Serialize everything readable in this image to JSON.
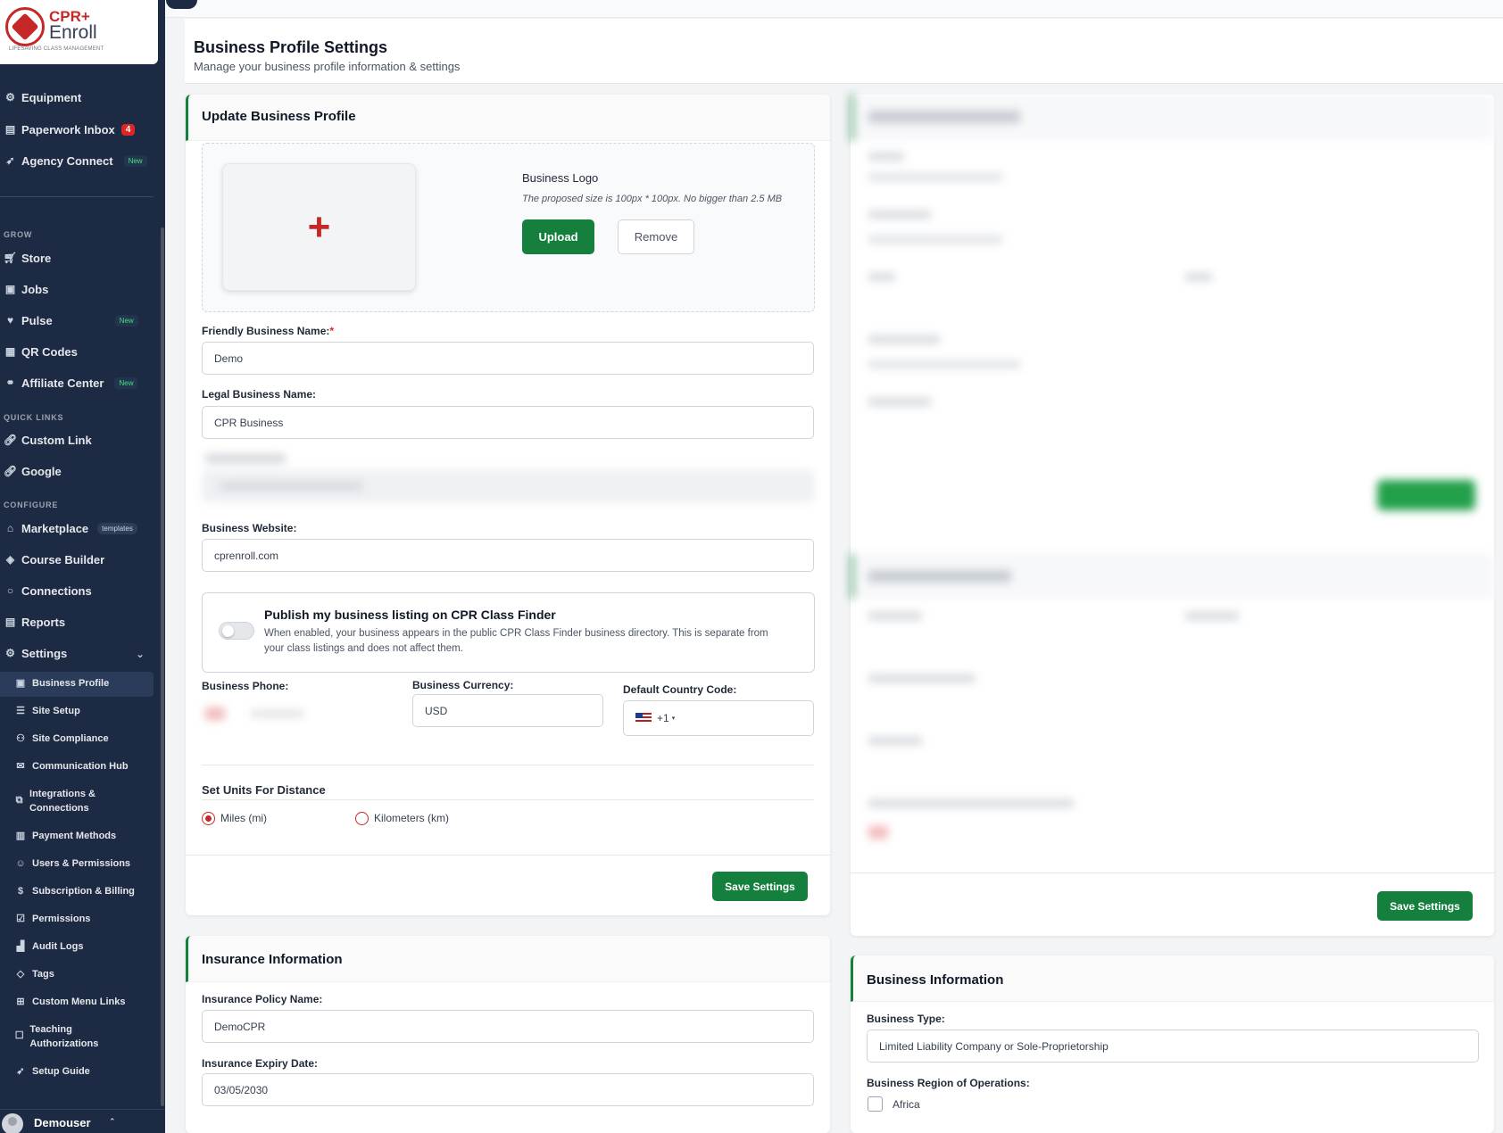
{
  "sidebar": {
    "logo_brand_top": "CPR+",
    "logo_brand_bottom": "Enroll",
    "logo_tagline": "LIFESAVING CLASS MANAGEMENT",
    "items_top": [
      {
        "label": "Equipment",
        "icon": "cog-group-icon"
      },
      {
        "label": "Paperwork Inbox",
        "icon": "inbox-icon",
        "badge": "4"
      },
      {
        "label": "Agency Connect",
        "icon": "rocket-icon",
        "badge": "New"
      }
    ],
    "section_grow": "GROW",
    "items_grow": [
      {
        "label": "Store",
        "icon": "cart-icon"
      },
      {
        "label": "Jobs",
        "icon": "briefcase-icon"
      },
      {
        "label": "Pulse",
        "icon": "heart-icon",
        "badge": "New"
      },
      {
        "label": "QR Codes",
        "icon": "qr-icon"
      },
      {
        "label": "Affiliate Center",
        "icon": "handshake-icon",
        "badge": "New"
      }
    ],
    "section_quick": "QUICK LINKS",
    "items_quick": [
      {
        "label": "Custom Link",
        "icon": "link-icon"
      },
      {
        "label": "Google",
        "icon": "link-icon"
      }
    ],
    "section_configure": "CONFIGURE",
    "items_configure": [
      {
        "label": "Marketplace",
        "icon": "store-icon",
        "badge": "templates"
      },
      {
        "label": "Course Builder",
        "icon": "graduation-icon"
      },
      {
        "label": "Connections",
        "icon": "plug-icon"
      },
      {
        "label": "Reports",
        "icon": "report-icon"
      },
      {
        "label": "Settings",
        "icon": "gear-icon"
      }
    ],
    "settings_sub": [
      {
        "label": "Business Profile",
        "icon": "building-icon"
      },
      {
        "label": "Site Setup",
        "icon": "sliders-icon"
      },
      {
        "label": "Site Compliance",
        "icon": "users-cog-icon"
      },
      {
        "label": "Communication Hub",
        "icon": "mail-icon"
      },
      {
        "label": "Integrations & Connections",
        "icon": "network-icon"
      },
      {
        "label": "Payment Methods",
        "icon": "receipt-icon"
      },
      {
        "label": "Users & Permissions",
        "icon": "user-icon"
      },
      {
        "label": "Subscription & Billing",
        "icon": "search-dollar-icon"
      },
      {
        "label": "Permissions",
        "icon": "clipboard-check-icon"
      },
      {
        "label": "Audit Logs",
        "icon": "chart-icon"
      },
      {
        "label": "Tags",
        "icon": "tag-icon"
      },
      {
        "label": "Custom Menu Links",
        "icon": "sitemap-icon"
      },
      {
        "label": "Teaching Authorizations",
        "icon": "clipboard-icon"
      },
      {
        "label": "Setup Guide",
        "icon": "rocket-icon"
      }
    ],
    "user_name": "Demouser"
  },
  "page": {
    "title": "Business Profile Settings",
    "subtitle": "Manage your business profile information & settings"
  },
  "profile_card": {
    "title": "Update Business Profile",
    "logo_label": "Business Logo",
    "logo_hint": "The proposed size is 100px * 100px. No bigger than 2.5 MB",
    "upload_label": "Upload",
    "remove_label": "Remove",
    "friendly_name_label": "Friendly Business Name:",
    "friendly_name_value": "Demo",
    "legal_name_label": "Legal Business Name:",
    "legal_name_value": "CPR Business",
    "website_label": "Business Website:",
    "website_value": "cprenroll.com",
    "publish_title": "Publish my business listing on CPR Class Finder",
    "publish_desc": "When enabled, your business appears in the public CPR Class Finder business directory. This is separate from your class listings and does not affect them.",
    "phone_label": "Business Phone:",
    "currency_label": "Business Currency:",
    "currency_value": "USD",
    "country_code_label": "Default Country Code:",
    "country_code_value": "+1",
    "units_label": "Set Units For Distance",
    "unit_miles": "Miles (mi)",
    "unit_km": "Kilometers (km)",
    "save_label": "Save Settings"
  },
  "right_card": {
    "save_label": "Save Settings"
  },
  "insurance_card": {
    "title": "Insurance Information",
    "policy_label": "Insurance Policy Name:",
    "policy_value": "DemoCPR",
    "expiry_label": "Insurance Expiry Date:",
    "expiry_value": "03/05/2030"
  },
  "business_info_card": {
    "title": "Business Information",
    "type_label": "Business Type:",
    "type_value": "Limited Liability Company or Sole-Proprietorship",
    "region_label": "Business Region of Operations:",
    "region_first": "Africa"
  },
  "colors": {
    "sidebar_bg": "#1c2a43",
    "accent_green": "#15803d",
    "brand_red": "#c62828"
  }
}
